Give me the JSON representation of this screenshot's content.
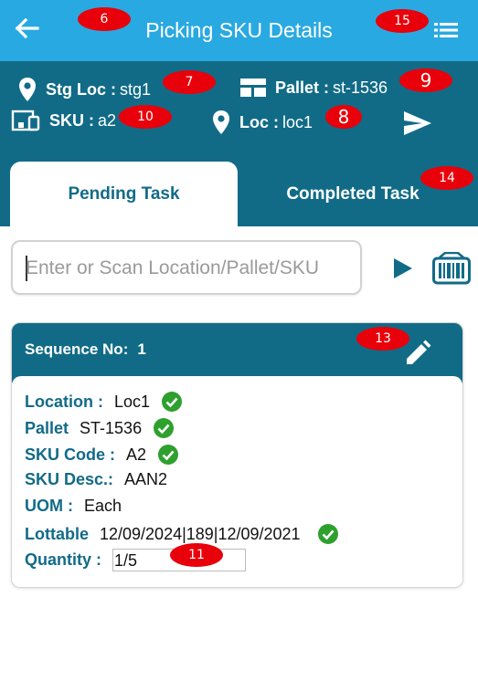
{
  "header": {
    "title": "Picking SKU Details"
  },
  "info": {
    "stg_loc_label": "Stg Loc :",
    "stg_loc_value": "stg1",
    "pallet_label": "Pallet :",
    "pallet_value": "st-1536",
    "sku_label": "SKU :",
    "sku_value": "a2",
    "loc_label": "Loc :",
    "loc_value": "loc1"
  },
  "tabs": {
    "pending": "Pending Task",
    "completed": "Completed Task"
  },
  "search": {
    "placeholder": "Enter or Scan Location/Pallet/SKU"
  },
  "card": {
    "sequence_label": "Sequence No:",
    "sequence_value": "1",
    "rows": [
      {
        "label": "Location :",
        "value": "Loc1"
      },
      {
        "label": "Pallet",
        "value": "ST-1536"
      },
      {
        "label": "SKU Code :",
        "value": "A2"
      },
      {
        "label": "SKU Desc.:",
        "value": "AAN2"
      },
      {
        "label": "UOM :",
        "value": "Each"
      },
      {
        "label": "Lottable",
        "value": "12/09/2024|189|12/09/2021"
      }
    ],
    "quantity_label": "Quantity :",
    "quantity_value": "1/5"
  },
  "markers": {
    "m6": "6",
    "m7": "7",
    "m8": "8",
    "m9": "9",
    "m10": "10",
    "m11": "11",
    "m13": "13",
    "m14": "14",
    "m15": "15"
  },
  "colors": {
    "appbar": "#29a9e1",
    "primary_dark": "#116b87",
    "check_green": "#2ea02e",
    "marker_red": "#e8000b"
  },
  "icons": {
    "back": "arrow-left-icon",
    "menu": "list-menu-icon",
    "location": "map-pin-icon",
    "pallet": "pallet-icon",
    "sku": "devices-icon",
    "send": "send-icon",
    "go": "play-icon",
    "scan": "barcode-scanner-icon",
    "edit": "pencil-icon",
    "check": "check-circle-icon"
  }
}
